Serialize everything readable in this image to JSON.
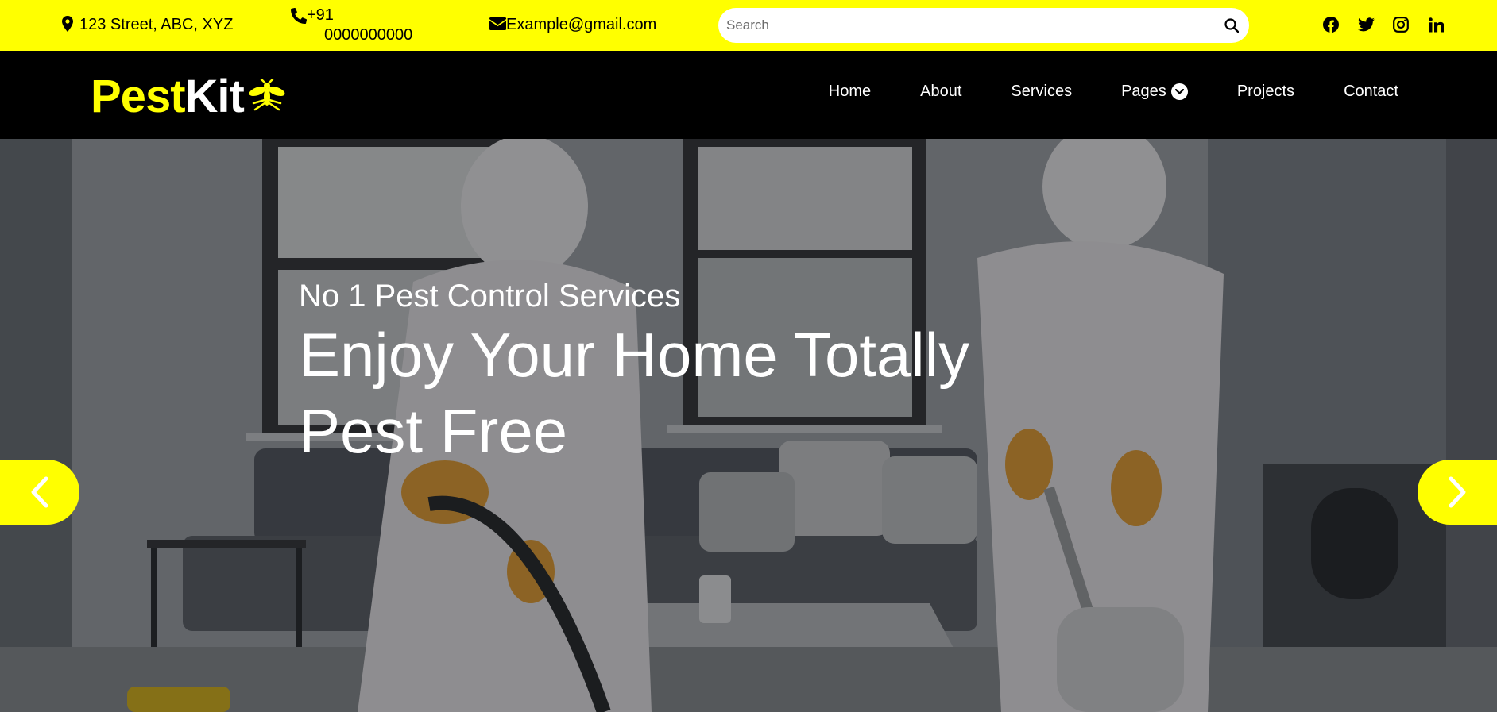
{
  "topbar": {
    "address": "123 Street, ABC, XYZ",
    "phone_line1": "+91",
    "phone_line2": "0000000000",
    "email": "Example@gmail.com",
    "search_placeholder": "Search",
    "icons": [
      "map-marker-icon",
      "phone-icon",
      "envelope-icon",
      "search-icon"
    ],
    "socials": [
      "facebook-icon",
      "twitter-icon",
      "instagram-icon",
      "linkedin-icon"
    ]
  },
  "navbar": {
    "logo_part1": "Pest",
    "logo_part2": "Kit",
    "logo_icon": "mosquito-icon",
    "links": {
      "home": "Home",
      "about": "About",
      "services": "Services",
      "pages": "Pages",
      "projects": "Projects",
      "contact": "Contact"
    }
  },
  "hero": {
    "subtitle": "No 1 Pest Control Services",
    "title_line1": "Enjoy Your Home Totally",
    "title_line2": "Pest Free",
    "prev_icon": "chevron-left-icon",
    "next_icon": "chevron-right-icon"
  },
  "colors": {
    "accent": "#ffff00",
    "nav_bg": "#000000",
    "text_light": "#ffffff"
  }
}
